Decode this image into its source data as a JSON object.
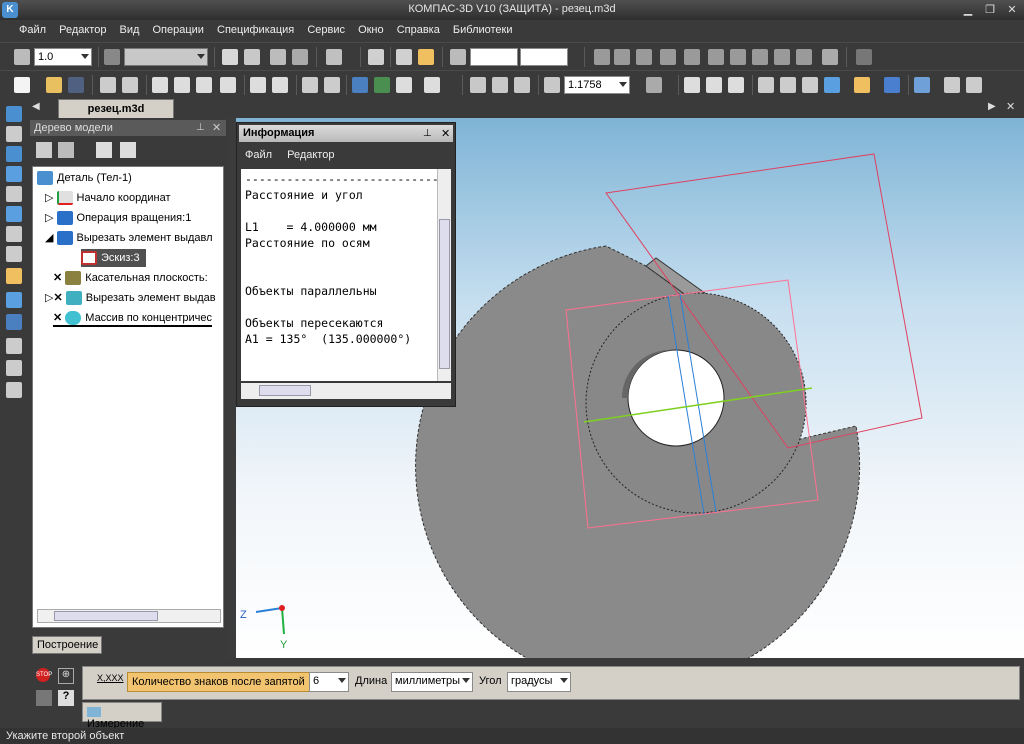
{
  "app": {
    "title": "КОМПАС-3D V10 (ЗАЩИТА) - резец.m3d"
  },
  "menu": [
    "Файл",
    "Редактор",
    "Вид",
    "Операции",
    "Спецификация",
    "Сервис",
    "Окно",
    "Справка",
    "Библиотеки"
  ],
  "toolbar1": {
    "scale_value": "1.0"
  },
  "toolbar2": {
    "zoom_value": "1.1758"
  },
  "document_tab": "резец.m3d",
  "tree": {
    "title": "Дерево модели",
    "items": [
      {
        "label": "Деталь (Тел-1)"
      },
      {
        "label": "Начало координат"
      },
      {
        "label": "Операция вращения:1"
      },
      {
        "label": "Вырезать элемент выдавл"
      },
      {
        "label": "Эскиз:3"
      },
      {
        "label": "Касательная плоскость:"
      },
      {
        "label": "Вырезать элемент выдав"
      },
      {
        "label": "Массив по концентричес"
      }
    ],
    "bottom_tab": "Построение"
  },
  "info": {
    "title": "Информация",
    "menu": [
      "Файл",
      "Редактор"
    ],
    "lines": [
      "------------------------------",
      "Расстояние и угол",
      "",
      "L1    = 4.000000 мм",
      "Расстояние по осям",
      "",
      "",
      "Объекты параллельны",
      "",
      "Объекты пересекаются",
      "A1 = 135°  (135.000000°)"
    ]
  },
  "axes": {
    "z": "Z",
    "y": "Y"
  },
  "measure": {
    "decimals_label": "Количество знаков после запятой",
    "decimals_value": "6",
    "length_label": "Длина",
    "length_value": "миллиметры",
    "angle_label": "Угол",
    "angle_value": "градусы",
    "tab": "Измерение"
  },
  "status": "Укажите второй объект",
  "colors": {
    "accent": "#f0c060",
    "dark_ui": "#3a3a3a"
  }
}
